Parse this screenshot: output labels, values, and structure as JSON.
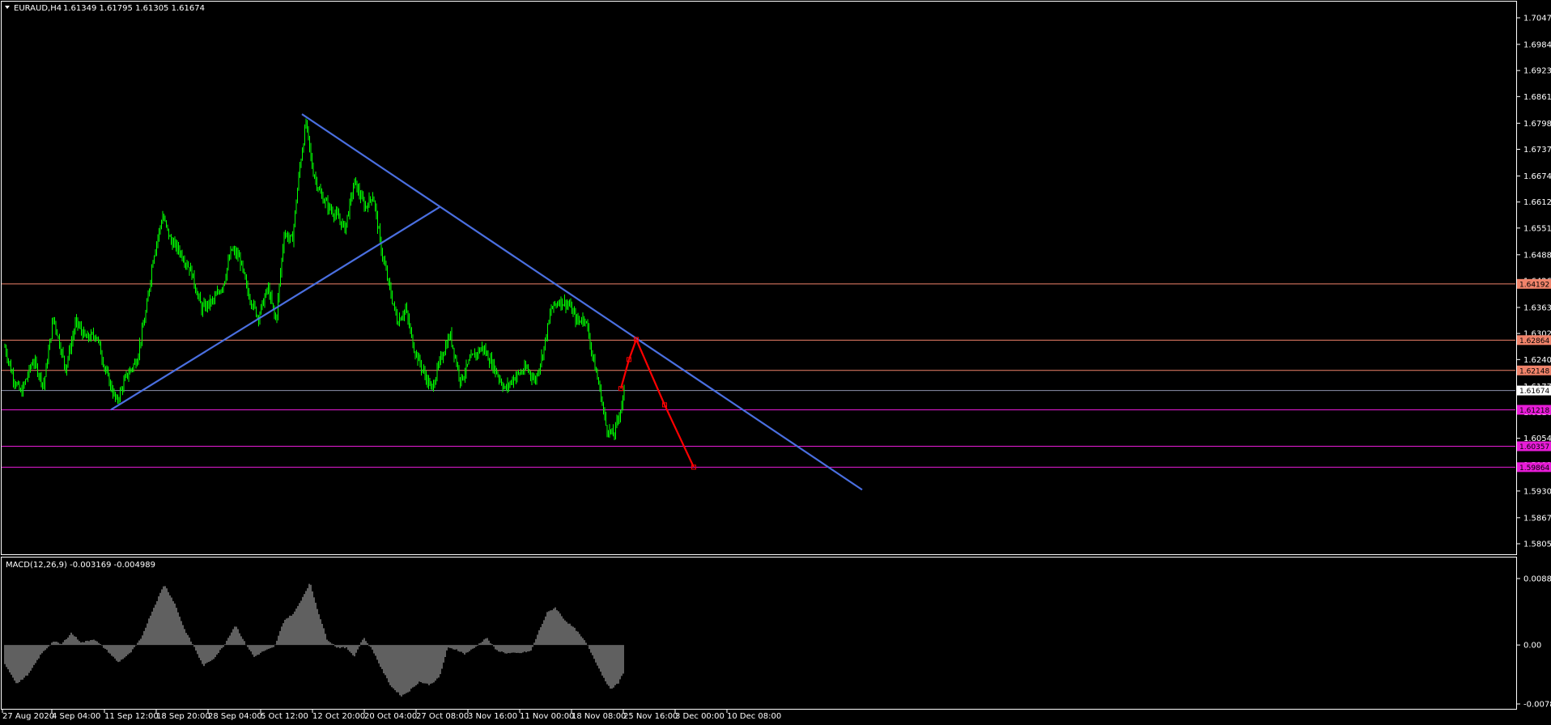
{
  "header": {
    "symbol": "EURAUD,H4",
    "ohlc": "1.61349 1.61795 1.61305 1.61674"
  },
  "colors": {
    "background": "#000000",
    "candle": "#00ff00",
    "trendline": "#4a6fe0",
    "projection": "#ff0000",
    "hline_orange": "#f0836a",
    "hline_magenta": "#e81cd8",
    "current_price_line": "#8c93ab",
    "macd_hist": "#c0c0c0",
    "frame": "#ffffff"
  },
  "chart_data": [
    {
      "type": "line",
      "panel": "price",
      "y_ticks": [
        "1.70475",
        "1.69848",
        "1.69230",
        "1.68615",
        "1.67985",
        "1.67370",
        "1.66740",
        "1.66125",
        "1.65510",
        "1.64880",
        "1.64265",
        "1.63635",
        "1.63020",
        "1.62405",
        "1.61775",
        "1.61160",
        "1.60545",
        "1.59915",
        "1.59300",
        "1.58670",
        "1.58055"
      ],
      "x_ticks": [
        "27 Aug 2020",
        "4 Sep 04:00",
        "11 Sep 12:00",
        "18 Sep 20:00",
        "28 Sep 04:00",
        "5 Oct 12:00",
        "12 Oct 20:00",
        "20 Oct 04:00",
        "27 Oct 08:00",
        "3 Nov 16:00",
        "11 Nov 00:00",
        "18 Nov 08:00",
        "25 Nov 16:00",
        "3 Dec 00:00",
        "10 Dec 08:00"
      ],
      "ylim": [
        1.58055,
        1.70475
      ],
      "price_anchors": [
        [
          0,
          1.627
        ],
        [
          10,
          1.62
        ],
        [
          20,
          1.616
        ],
        [
          35,
          1.624
        ],
        [
          48,
          1.618
        ],
        [
          60,
          1.634
        ],
        [
          75,
          1.622
        ],
        [
          88,
          1.633
        ],
        [
          100,
          1.629
        ],
        [
          113,
          1.63
        ],
        [
          125,
          1.621
        ],
        [
          138,
          1.614
        ],
        [
          150,
          1.62
        ],
        [
          163,
          1.624
        ],
        [
          175,
          1.636
        ],
        [
          183,
          1.648
        ],
        [
          195,
          1.658
        ],
        [
          205,
          1.652
        ],
        [
          215,
          1.65
        ],
        [
          230,
          1.645
        ],
        [
          243,
          1.636
        ],
        [
          258,
          1.638
        ],
        [
          270,
          1.642
        ],
        [
          280,
          1.65
        ],
        [
          290,
          1.648
        ],
        [
          300,
          1.64
        ],
        [
          313,
          1.634
        ],
        [
          325,
          1.641
        ],
        [
          335,
          1.633
        ],
        [
          345,
          1.654
        ],
        [
          355,
          1.652
        ],
        [
          364,
          1.669
        ],
        [
          372,
          1.68
        ],
        [
          380,
          1.669
        ],
        [
          390,
          1.663
        ],
        [
          400,
          1.66
        ],
        [
          410,
          1.658
        ],
        [
          420,
          1.655
        ],
        [
          432,
          1.666
        ],
        [
          445,
          1.66
        ],
        [
          455,
          1.663
        ],
        [
          465,
          1.65
        ],
        [
          475,
          1.641
        ],
        [
          485,
          1.633
        ],
        [
          495,
          1.636
        ],
        [
          505,
          1.627
        ],
        [
          515,
          1.622
        ],
        [
          527,
          1.617
        ],
        [
          540,
          1.625
        ],
        [
          550,
          1.63
        ],
        [
          563,
          1.619
        ],
        [
          575,
          1.624
        ],
        [
          590,
          1.627
        ],
        [
          605,
          1.622
        ],
        [
          618,
          1.617
        ],
        [
          630,
          1.62
        ],
        [
          645,
          1.622
        ],
        [
          655,
          1.619
        ],
        [
          665,
          1.626
        ],
        [
          675,
          1.636
        ],
        [
          685,
          1.638
        ],
        [
          697,
          1.637
        ],
        [
          707,
          1.633
        ],
        [
          717,
          1.634
        ],
        [
          727,
          1.624
        ],
        [
          735,
          1.617
        ],
        [
          743,
          1.608
        ],
        [
          752,
          1.606
        ],
        [
          760,
          1.612
        ],
        [
          765,
          1.616
        ]
      ],
      "price_anchor_index_range": [
        0,
        900
      ],
      "h_levels": [
        {
          "price": 1.64192,
          "label": "1.64192",
          "color": "#f0836a"
        },
        {
          "price": 1.62864,
          "label": "1.62864",
          "color": "#f0836a"
        },
        {
          "price": 1.62148,
          "label": "1.62148",
          "color": "#f0836a"
        },
        {
          "price": 1.61674,
          "label": "1.61674",
          "color": "#8c93ab",
          "current": true
        },
        {
          "price": 1.61218,
          "label": "1.61218",
          "color": "#e81cd8"
        },
        {
          "price": 1.60357,
          "label": "1.60357",
          "color": "#e81cd8"
        },
        {
          "price": 1.59864,
          "label": "1.59864",
          "color": "#e81cd8"
        }
      ],
      "trendlines": [
        {
          "from": [
            137,
            1.61218
          ],
          "to": [
            543,
            1.66005
          ],
          "color": "#4a6fe0"
        },
        {
          "from": [
            373,
            1.682
          ],
          "to": [
            1065,
            1.5933
          ],
          "color": "#4a6fe0"
        }
      ],
      "projection_path": [
        [
          767,
          1.6172
        ],
        [
          777,
          1.62405
        ],
        [
          786,
          1.6288
        ],
        [
          821,
          1.61335
        ],
        [
          857,
          1.59864
        ]
      ]
    },
    {
      "type": "bar",
      "panel": "indicator",
      "title": "MACD(12,26,9) -0.003169 -0.004989",
      "y_ticks": [
        "0.008848",
        "0.00",
        "-0.007852"
      ],
      "ylim": [
        -0.007852,
        0.008848
      ],
      "macd_anchors": [
        [
          0,
          -0.0025
        ],
        [
          15,
          -0.0052
        ],
        [
          30,
          -0.0038
        ],
        [
          45,
          -0.0012
        ],
        [
          60,
          0.0005
        ],
        [
          70,
          0.0001
        ],
        [
          82,
          0.0016
        ],
        [
          95,
          0.0003
        ],
        [
          110,
          0.0008
        ],
        [
          125,
          -0.0006
        ],
        [
          140,
          -0.0023
        ],
        [
          155,
          -0.0011
        ],
        [
          168,
          0.0008
        ],
        [
          180,
          0.004
        ],
        [
          197,
          0.0081
        ],
        [
          210,
          0.0055
        ],
        [
          222,
          0.0021
        ],
        [
          235,
          -0.0005
        ],
        [
          245,
          -0.0028
        ],
        [
          258,
          -0.0018
        ],
        [
          270,
          -0.0002
        ],
        [
          285,
          0.0027
        ],
        [
          295,
          0.0006
        ],
        [
          308,
          -0.0016
        ],
        [
          320,
          -0.0008
        ],
        [
          333,
          -0.0003
        ],
        [
          345,
          0.0033
        ],
        [
          357,
          0.0042
        ],
        [
          368,
          0.0064
        ],
        [
          377,
          0.0083
        ],
        [
          387,
          0.0045
        ],
        [
          398,
          0.0008
        ],
        [
          410,
          -0.0003
        ],
        [
          422,
          -0.0004
        ],
        [
          432,
          -0.0015
        ],
        [
          443,
          0.001
        ],
        [
          455,
          -0.0008
        ],
        [
          465,
          -0.0031
        ],
        [
          477,
          -0.0055
        ],
        [
          490,
          -0.0068
        ],
        [
          500,
          -0.0061
        ],
        [
          512,
          -0.0049
        ],
        [
          525,
          -0.0053
        ],
        [
          537,
          -0.0043
        ],
        [
          547,
          -0.0004
        ],
        [
          558,
          -0.0006
        ],
        [
          568,
          -0.0012
        ],
        [
          580,
          -0.0004
        ],
        [
          595,
          0.001
        ],
        [
          607,
          -0.0007
        ],
        [
          620,
          -0.0011
        ],
        [
          635,
          -0.0011
        ],
        [
          650,
          -0.0008
        ],
        [
          660,
          0.0019
        ],
        [
          670,
          0.0043
        ],
        [
          680,
          0.005
        ],
        [
          692,
          0.0033
        ],
        [
          705,
          0.0021
        ],
        [
          718,
          0.0003
        ],
        [
          728,
          -0.0018
        ],
        [
          738,
          -0.004
        ],
        [
          748,
          -0.0059
        ],
        [
          758,
          -0.0051
        ],
        [
          765,
          -0.0035
        ]
      ]
    }
  ]
}
